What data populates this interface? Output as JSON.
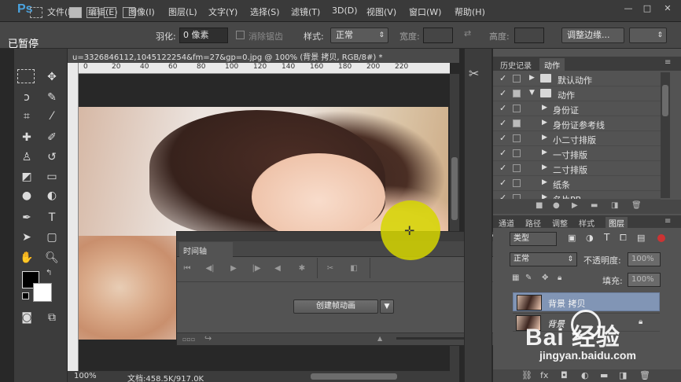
{
  "app": {
    "logo": "Ps",
    "menus": [
      "文件(F)",
      "编辑(E)",
      "图像(I)",
      "图层(L)",
      "文字(Y)",
      "选择(S)",
      "滤镜(T)",
      "3D(D)",
      "视图(V)",
      "窗口(W)",
      "帮助(H)"
    ],
    "window_controls": [
      "—",
      "□",
      "✕"
    ]
  },
  "overlay": {
    "paused": "已暂停"
  },
  "options_bar": {
    "feather_label": "羽化:",
    "feather_value": "0 像素",
    "antialias_label": "消除锯齿",
    "style_label": "样式:",
    "style_value": "正常",
    "width_label": "宽度:",
    "height_label": "高度:",
    "refine_edge": "调整边缘..."
  },
  "document": {
    "tab_title": "u=3326846112,1045122254&fm=27&gp=0.jpg @ 100% (背景 拷贝, RGB/8#) *",
    "ruler_h": [
      "0",
      "20",
      "40",
      "60",
      "80",
      "100",
      "120",
      "140",
      "160",
      "180",
      "200",
      "220"
    ],
    "zoom": "100%",
    "doc_size": "文档:458.5K/917.0K"
  },
  "timeline": {
    "tab": "时间轴",
    "create_button": "创建帧动画",
    "controls": [
      "⏮",
      "◀|",
      "▶",
      "|▶",
      "◀",
      "✱",
      "✂",
      "◧"
    ]
  },
  "actions_panel": {
    "tabs": [
      "历史记录",
      "动作"
    ],
    "active_tab": "动作",
    "rows": [
      {
        "check": "✓",
        "label": "默认动作",
        "type": "set",
        "expanded": false
      },
      {
        "check": "✓",
        "label": "动作",
        "type": "set",
        "expanded": true
      },
      {
        "check": "✓",
        "label": "身份证",
        "type": "action"
      },
      {
        "check": "✓",
        "label": "身份证参考线",
        "type": "action"
      },
      {
        "check": "✓",
        "label": "小二寸排版",
        "type": "action"
      },
      {
        "check": "✓",
        "label": "一寸排版",
        "type": "action"
      },
      {
        "check": "✓",
        "label": "二寸排版",
        "type": "action"
      },
      {
        "check": "✓",
        "label": "纸条",
        "type": "action"
      },
      {
        "check": "✓",
        "label": "名片PB",
        "type": "action"
      }
    ]
  },
  "layers_panel": {
    "tabs": [
      "通道",
      "路径",
      "调整",
      "样式",
      "图层"
    ],
    "active_tab": "图层",
    "filter": "类型",
    "blend_mode": "正常",
    "opacity_label": "不透明度:",
    "opacity_value": "100%",
    "fill_label": "填充:",
    "fill_value": "100%",
    "layers": [
      {
        "name": "背景 拷贝",
        "selected": true
      },
      {
        "name": "背景",
        "selected": false,
        "locked": true
      }
    ],
    "footer_icons": [
      "link-icon",
      "fx-icon",
      "mask-icon",
      "adjustment-icon",
      "folder-icon",
      "new-layer-icon",
      "trash-icon"
    ]
  },
  "watermark": {
    "logo": "Bai  经验",
    "url": "jingyan.baidu.com"
  },
  "colors": {
    "accent": "#4aa3df",
    "selected_layer": "#8195b5",
    "highlight": "#d6d600"
  }
}
